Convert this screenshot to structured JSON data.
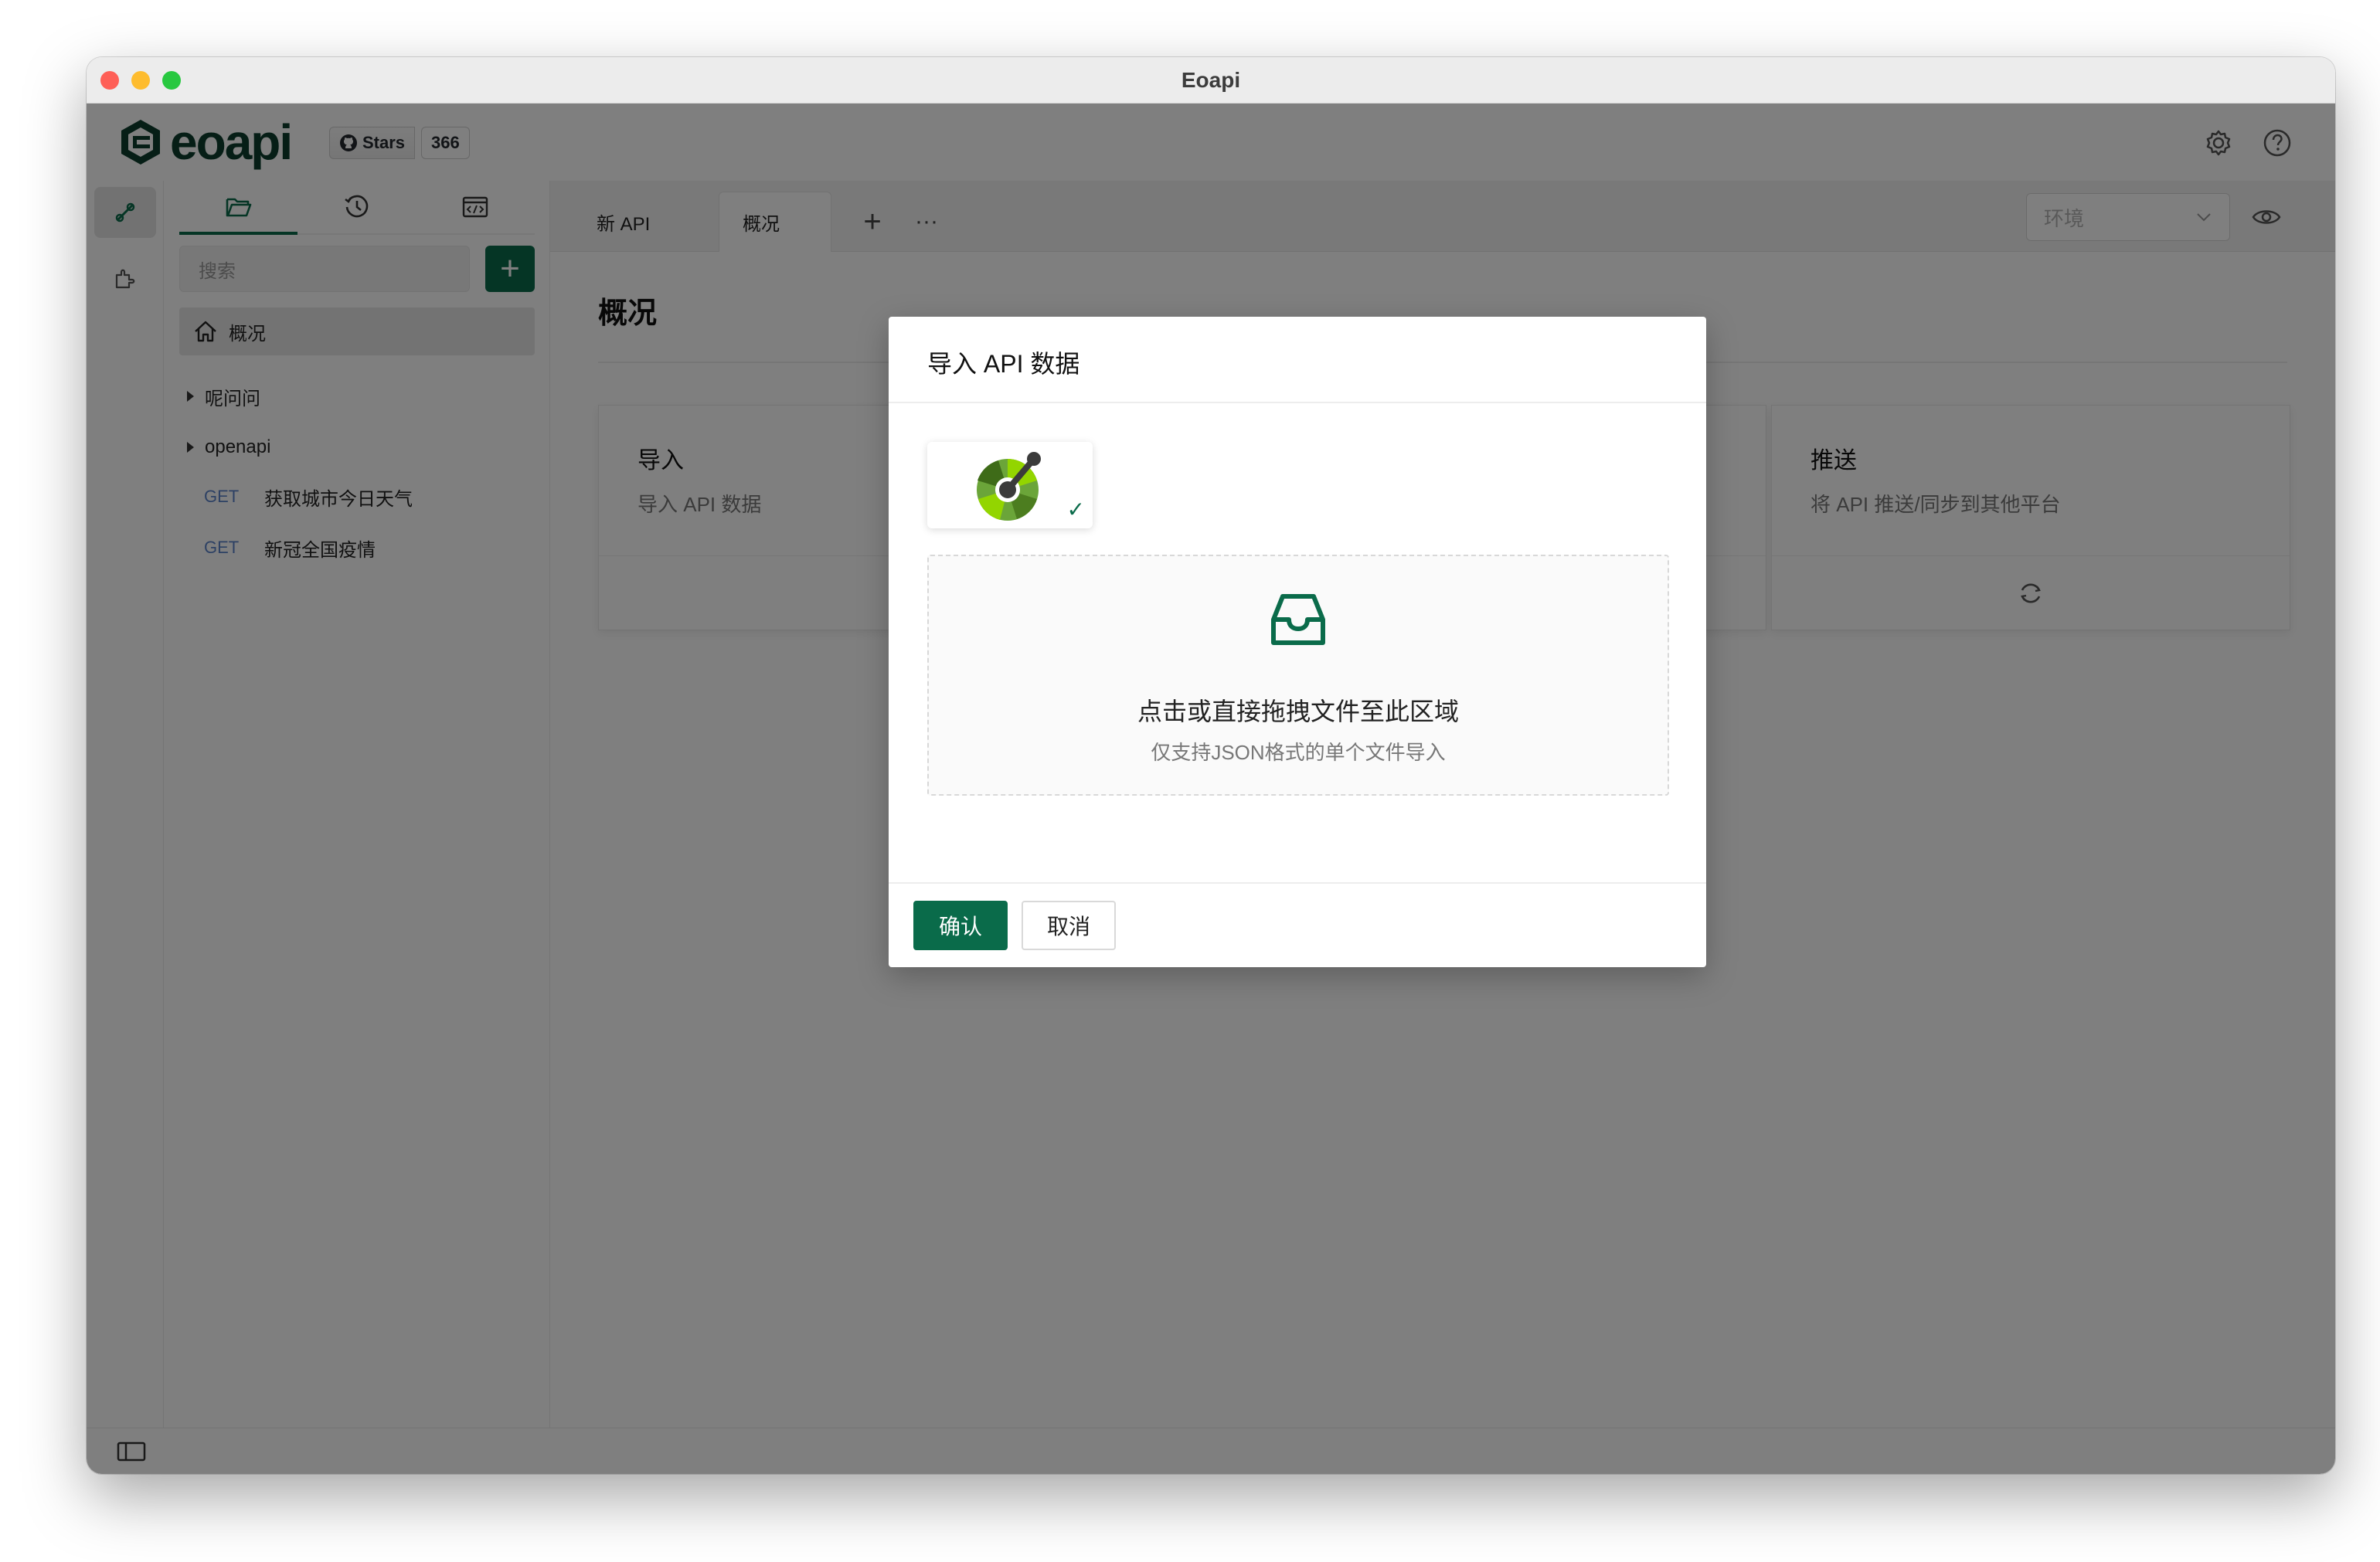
{
  "window": {
    "title": "Eoapi"
  },
  "header": {
    "logo_text": "eoapi",
    "github_stars_label": "Stars",
    "github_stars_count": "366",
    "icons": [
      "gear-icon",
      "help-icon"
    ]
  },
  "rail": {
    "items": [
      "api-icon",
      "plugin-icon"
    ]
  },
  "sidebar": {
    "tabs": [
      "folder-icon",
      "history-icon",
      "code-icon"
    ],
    "search_placeholder": "搜索",
    "add_label": "+",
    "overview_label": "概况",
    "groups": [
      {
        "label": "呢问问"
      },
      {
        "label": "openapi"
      }
    ],
    "apis": [
      {
        "method": "GET",
        "name": "获取城市今日天气"
      },
      {
        "method": "GET",
        "name": "新冠全国疫情"
      }
    ]
  },
  "tabs": {
    "items": [
      {
        "label": "新 API"
      },
      {
        "label": "概况"
      }
    ],
    "add_label": "+",
    "more_label": "···",
    "env_placeholder": "环境"
  },
  "main": {
    "title": "概况",
    "cards": [
      {
        "title": "导入",
        "desc": "导入 API 数据"
      },
      {
        "title": "推送",
        "desc": "将 API 推送/同步到其他平台"
      }
    ]
  },
  "modal": {
    "title": "导入 API 数据",
    "format_check": "✓",
    "dropzone_title": "点击或直接拖拽文件至此区域",
    "dropzone_hint": "仅支持JSON格式的单个文件导入",
    "confirm_label": "确认",
    "cancel_label": "取消"
  },
  "colors": {
    "primary": "#0a6b4a",
    "method_get": "#5b82c9"
  }
}
